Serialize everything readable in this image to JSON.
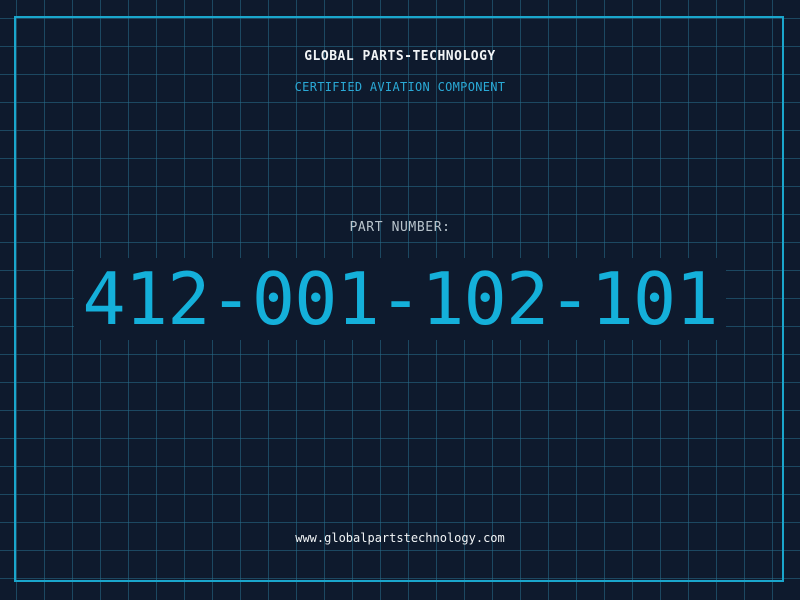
{
  "header": {
    "company": "GLOBAL PARTS-TECHNOLOGY",
    "subtitle": "CERTIFIED AVIATION COMPONENT"
  },
  "part": {
    "label": "PART NUMBER:",
    "number": "412-001-102-101"
  },
  "footer": {
    "website": "www.globalpartstechnology.com"
  },
  "colors": {
    "background": "#0e1a2d",
    "grid": "#286e8c",
    "accent": "#14b0da",
    "border": "#1aa6cc",
    "text_primary": "#f1f4f6",
    "text_muted": "#b9c4cc"
  }
}
